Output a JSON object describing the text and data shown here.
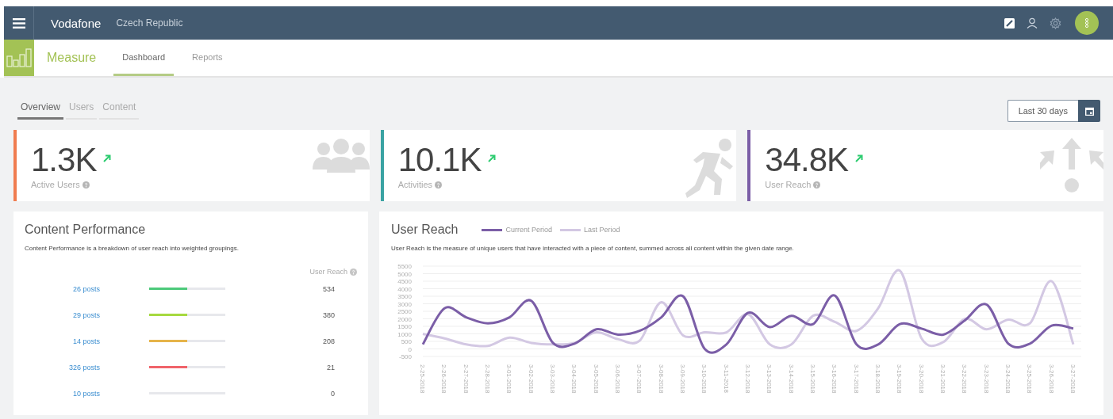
{
  "topbar": {
    "brand": "Vodafone",
    "region": "Czech Republic"
  },
  "module": {
    "title": "Measure"
  },
  "nav_tabs": [
    {
      "label": "Dashboard",
      "selected": true
    },
    {
      "label": "Reports",
      "selected": false
    }
  ],
  "view_tabs": [
    {
      "label": "Overview",
      "selected": true
    },
    {
      "label": "Users",
      "selected": false
    },
    {
      "label": "Content",
      "selected": false
    }
  ],
  "date_range": {
    "label": "Last 30 days"
  },
  "stats": [
    {
      "value": "1.3K",
      "label": "Active Users",
      "color": "#f07c4f",
      "kind": "users"
    },
    {
      "value": "10.1K",
      "label": "Activities",
      "color": "#3aa3a3",
      "kind": "runner"
    },
    {
      "value": "34.8K",
      "label": "User Reach",
      "color": "#7b5ea7",
      "kind": "arrows"
    }
  ],
  "content_performance": {
    "title": "Content Performance",
    "description": "Content Performance is a breakdown of user reach into weighted groupings.",
    "column": "User Reach",
    "rows": [
      {
        "label": "26 posts",
        "level": 0.5,
        "color": "#4cc97a",
        "value": "534"
      },
      {
        "label": "29 posts",
        "level": 0.5,
        "color": "#a6d93f",
        "value": "380"
      },
      {
        "label": "14 posts",
        "level": 0.5,
        "color": "#e6b44a",
        "value": "208"
      },
      {
        "label": "326 posts",
        "level": 0.5,
        "color": "#f0636a",
        "value": "21"
      },
      {
        "label": "10 posts",
        "value": "0"
      }
    ]
  },
  "user_reach": {
    "title": "User Reach",
    "description": "User Reach is the measure of unique users that have interacted with a piece of content, summed across all content within the given date range.",
    "chart_data": {
      "type": "line",
      "x": [
        "2-25-2018",
        "2-26-2018",
        "2-27-2018",
        "2-28-2018",
        "3-01-2018",
        "3-02-2018",
        "3-03-2018",
        "3-04-2018",
        "3-05-2018",
        "3-06-2018",
        "3-07-2018",
        "3-08-2018",
        "3-09-2018",
        "3-10-2018",
        "3-11-2018",
        "3-12-2018",
        "3-13-2018",
        "3-14-2018",
        "3-15-2018",
        "3-16-2018",
        "3-17-2018",
        "3-18-2018",
        "3-19-2018",
        "3-20-2018",
        "3-21-2018",
        "3-22-2018",
        "3-23-2018",
        "3-24-2018",
        "3-25-2018",
        "3-26-2018",
        "3-27-2018"
      ],
      "grid": true,
      "ylim": [
        -500,
        5500
      ],
      "yticks": [
        -500,
        0,
        500,
        1000,
        1500,
        2000,
        2500,
        3000,
        3500,
        4000,
        4500,
        5000,
        5500
      ],
      "series": [
        {
          "name": "Current Period",
          "color": "#7b5ea7",
          "values": [
            300,
            2700,
            2100,
            1700,
            2100,
            3200,
            400,
            350,
            1300,
            950,
            1200,
            2100,
            3500,
            0,
            300,
            2400,
            1450,
            2200,
            1650,
            3550,
            300,
            300,
            1650,
            1350,
            950,
            1900,
            2950,
            350,
            350,
            1550,
            1350
          ]
        },
        {
          "name": "Last Period",
          "color": "#d3c8e3",
          "values": [
            1000,
            700,
            300,
            200,
            750,
            400,
            300,
            400,
            1100,
            650,
            550,
            3100,
            900,
            1100,
            1100,
            2300,
            300,
            300,
            2200,
            1800,
            1200,
            2700,
            5200,
            700,
            450,
            2000,
            1300,
            1950,
            1700,
            4500,
            300
          ]
        }
      ]
    }
  }
}
